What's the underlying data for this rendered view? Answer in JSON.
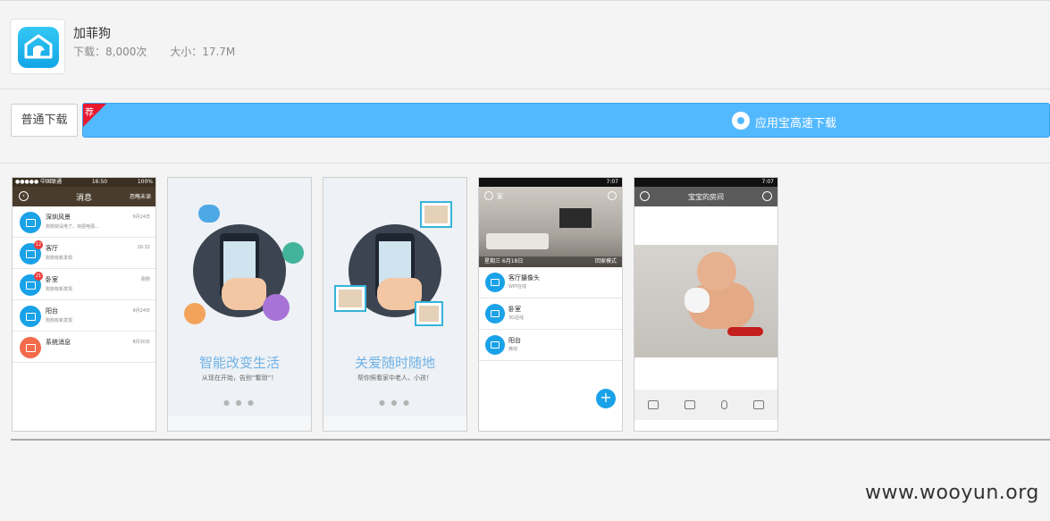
{
  "app": {
    "name": "加菲狗",
    "downloads": "下载：8,000次",
    "size": "大小：17.7M"
  },
  "buttons": {
    "normal_download": "普通下载",
    "fast_download": "应用宝高速下载",
    "recommend_tag": "荐"
  },
  "screens": {
    "messages": {
      "status_left": "●●●●● 中国联通",
      "status_time": "16:50",
      "status_right": "100%",
      "title": "消息",
      "action": "忽略未读",
      "items": [
        {
          "title": "深圳风景",
          "sub": "狗狗快没电了，快把电源...",
          "date": "9月24日",
          "badge": ""
        },
        {
          "title": "客厅",
          "sub": "狗狗有新发现",
          "date": "16:32",
          "badge": "12"
        },
        {
          "title": "卧室",
          "sub": "狗狗有新发现",
          "date": "刚刚",
          "badge": "21"
        },
        {
          "title": "阳台",
          "sub": "狗狗有新发现",
          "date": "9月24日",
          "badge": ""
        },
        {
          "title": "系统消息",
          "sub": "",
          "date": "8月30日",
          "badge": ""
        }
      ]
    },
    "splash1": {
      "title": "智能改变生活",
      "desc": "从现在开始，告别“繁琐”！",
      "dots": "● ● ●"
    },
    "splash2": {
      "title": "关爱随时随地",
      "desc": "帮你照看家中老人、小孩！",
      "dots": "● ● ●"
    },
    "home": {
      "status_time": "7:07",
      "title": "家",
      "date": "星期三 6月18日",
      "mode": "回家模式",
      "cameras": [
        {
          "title": "客厅摄像头",
          "sub": "WiFi在线"
        },
        {
          "title": "卧室",
          "sub": "3G在线"
        },
        {
          "title": "阳台",
          "sub": "离线"
        }
      ],
      "fab": "+"
    },
    "video": {
      "status_time": "7:07",
      "title": "宝宝的房间"
    }
  },
  "watermark": "www.wooyun.org"
}
